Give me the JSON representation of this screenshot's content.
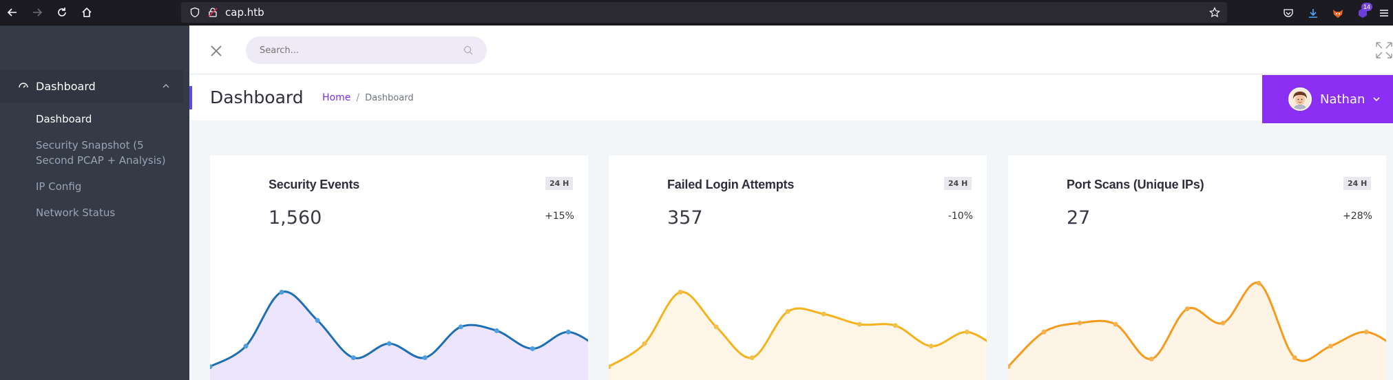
{
  "browser": {
    "url": "cap.htb",
    "extension_badge": "14"
  },
  "sidebar": {
    "menu": {
      "label": "Dashboard",
      "items": [
        {
          "label": "Dashboard",
          "active": true
        },
        {
          "label": "Security Snapshot (5",
          "label2": "Second PCAP + Analysis)"
        },
        {
          "label": "IP Config"
        },
        {
          "label": "Network Status"
        }
      ]
    }
  },
  "topbar": {
    "search_placeholder": "Search..."
  },
  "header": {
    "title": "Dashboard",
    "breadcrumb": {
      "home": "Home",
      "separator": "/",
      "current": "Dashboard"
    },
    "user": "Nathan"
  },
  "cards": [
    {
      "title": "Security Events",
      "value": "1,560",
      "period": "24 H",
      "change": "+15%",
      "color": "#1d6fb5",
      "fill": "#ede5fb",
      "point_color": "#4f9ee0",
      "points": [
        10,
        42,
        126,
        82,
        24,
        46,
        24,
        72,
        66,
        38,
        64,
        33
      ]
    },
    {
      "title": "Failed Login Attempts",
      "value": "357",
      "period": "24 H",
      "change": "-10%",
      "color": "#f5b21b",
      "fill": "#fdf5e6",
      "point_color": "#f5c04a",
      "points": [
        10,
        46,
        126,
        72,
        24,
        96,
        92,
        76,
        74,
        42,
        64,
        33
      ]
    },
    {
      "title": "Port Scans (Unique IPs)",
      "value": "27",
      "period": "24 H",
      "change": "+28%",
      "color": "#f79a1b",
      "fill": "#fdf4e6",
      "point_color": "#f9b14d",
      "points": [
        10,
        64,
        78,
        76,
        22,
        100,
        78,
        140,
        24,
        42,
        64,
        33
      ]
    }
  ]
}
